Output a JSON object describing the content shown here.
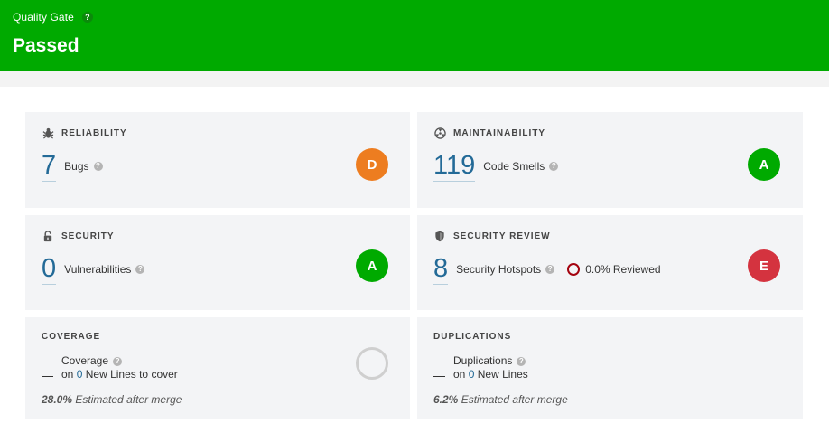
{
  "quality_gate": {
    "label": "Quality Gate",
    "help": "?",
    "status": "Passed",
    "color": "#00aa00"
  },
  "reliability": {
    "title": "RELIABILITY",
    "icon": "bug-icon",
    "value": "7",
    "label": "Bugs",
    "rating": "D",
    "rating_color": "#ed7d20"
  },
  "maintainability": {
    "title": "MAINTAINABILITY",
    "icon": "radiation-icon",
    "value": "119",
    "label": "Code Smells",
    "rating": "A",
    "rating_color": "#00aa00"
  },
  "security": {
    "title": "SECURITY",
    "icon": "lock-icon",
    "value": "0",
    "label": "Vulnerabilities",
    "rating": "A",
    "rating_color": "#00aa00"
  },
  "security_review": {
    "title": "SECURITY REVIEW",
    "icon": "shield-icon",
    "value": "8",
    "label": "Security Hotspots",
    "reviewed": "0.0% Reviewed",
    "rating": "E",
    "rating_color": "#d4333f"
  },
  "coverage": {
    "title": "COVERAGE",
    "dash": "—",
    "label": "Coverage",
    "on_prefix": "on",
    "new_lines": "0",
    "suffix": "New Lines to cover",
    "estimate_value": "28.0%",
    "estimate_text": "Estimated after merge"
  },
  "duplications": {
    "title": "DUPLICATIONS",
    "dash": "—",
    "label": "Duplications",
    "on_prefix": "on",
    "new_lines": "0",
    "suffix": "New Lines",
    "estimate_value": "6.2%",
    "estimate_text": "Estimated after merge"
  }
}
